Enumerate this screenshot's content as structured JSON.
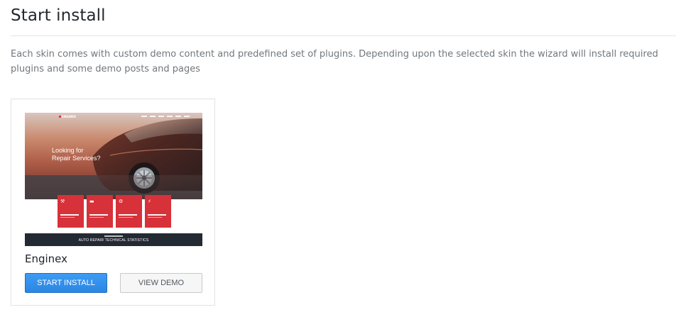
{
  "page": {
    "title": "Start install",
    "description": "Each skin comes with custom demo content and predefined set of plugins. Depending upon the selected skin the wizard will install required plugins and some demo posts and pages"
  },
  "skins": [
    {
      "name": "Enginex",
      "preview": {
        "logo": "ENGINEX",
        "headline_line1": "Looking for",
        "headline_line2": "Repair Services?",
        "service_icons": [
          "wrench-icon",
          "car-icon",
          "gear-icon",
          "bolt-icon"
        ],
        "stats_title": "AUTO REPAIR TECHNICAL STATISTICS"
      },
      "start_label": "START INSTALL",
      "demo_label": "VIEW DEMO"
    }
  ],
  "colors": {
    "primary_button": "#2b86e2",
    "service_box": "#d7313a",
    "stats_bar": "#242a33"
  }
}
